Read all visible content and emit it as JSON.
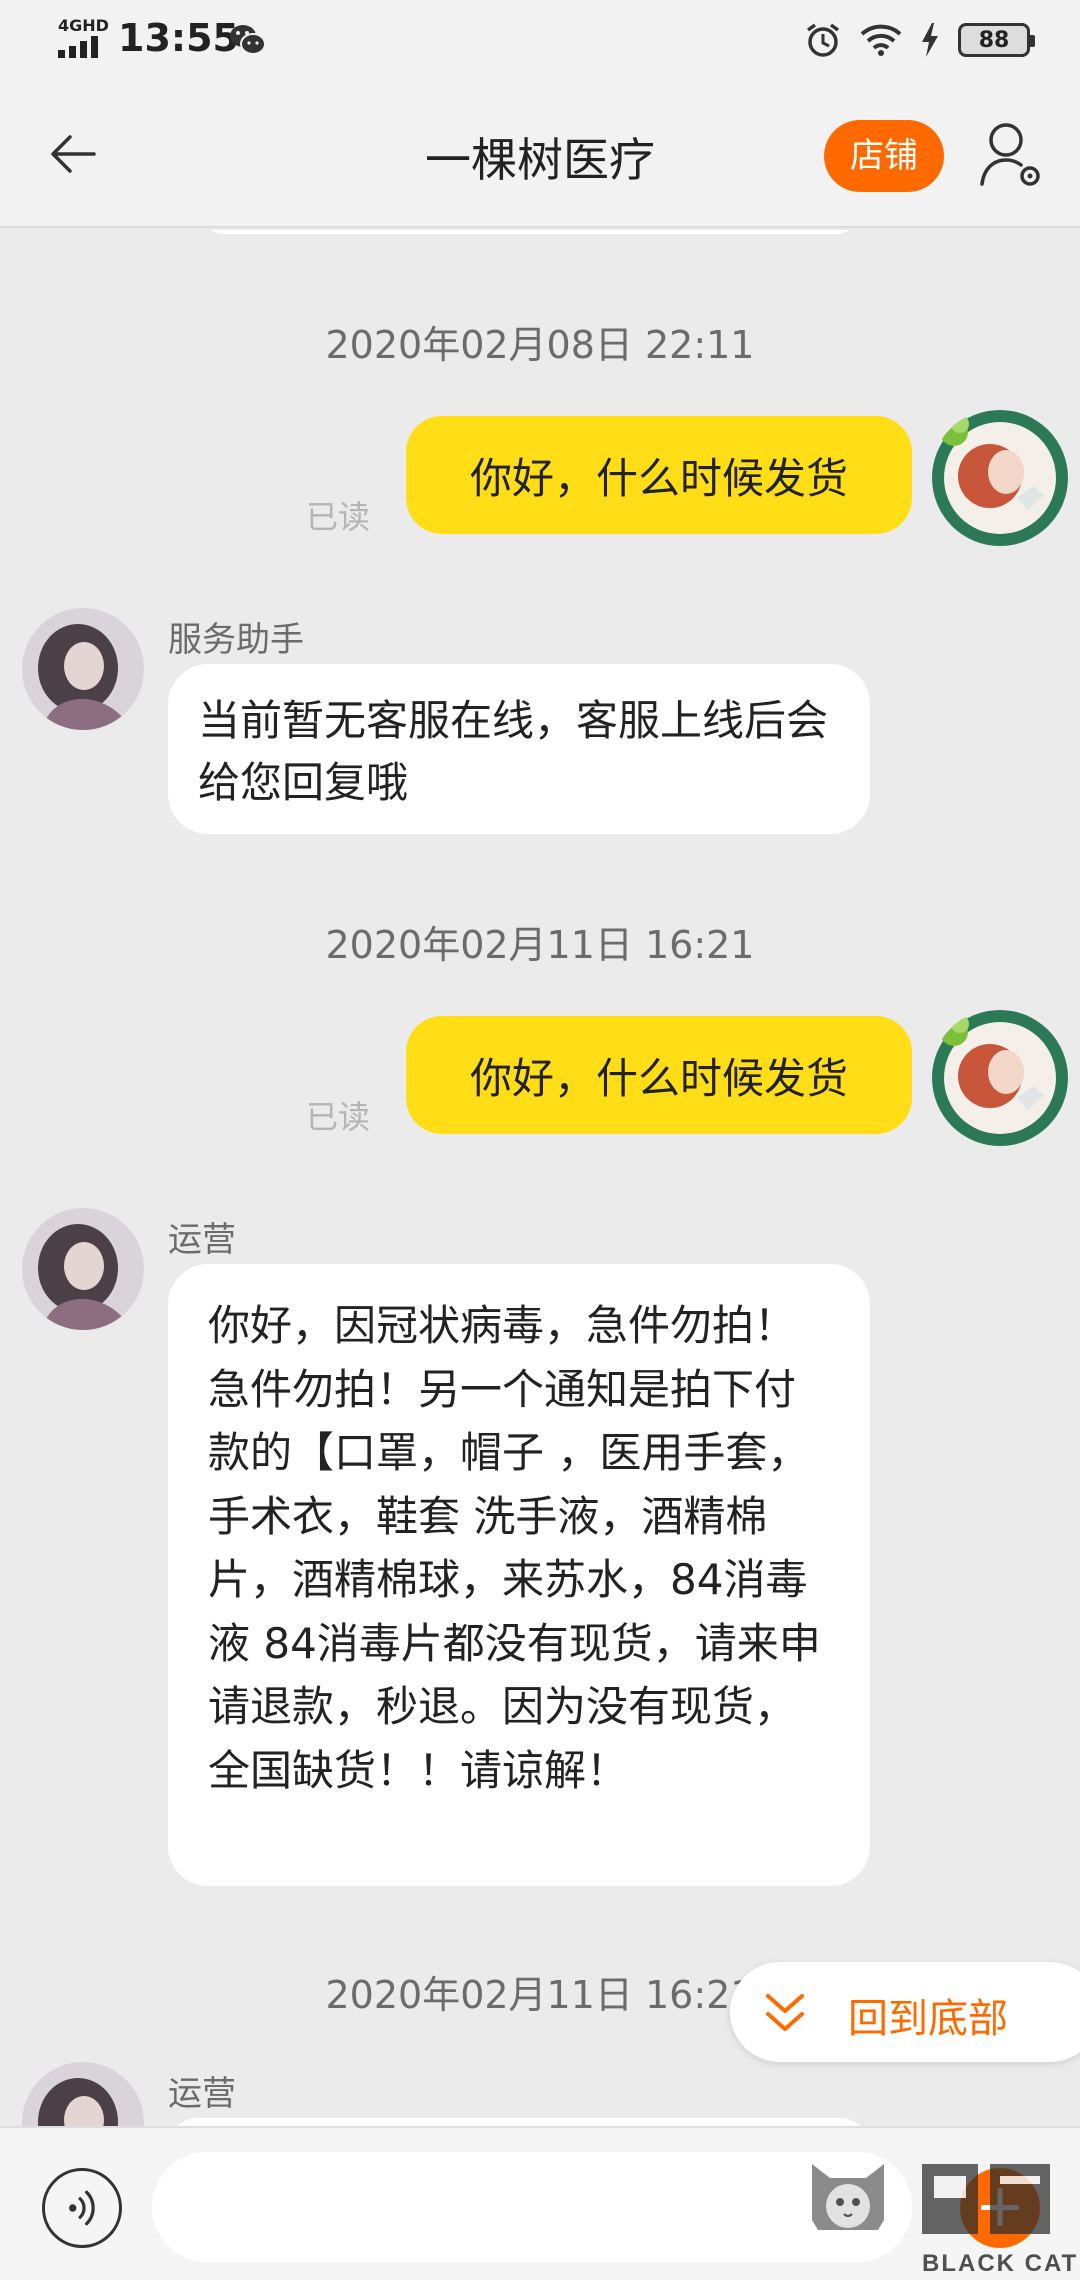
{
  "status_bar": {
    "network": "4GHD",
    "time": "13:55",
    "battery": "88"
  },
  "header": {
    "title": "一棵树医疗",
    "store_label": "店铺"
  },
  "messages": {
    "ts1": "2020年02月08日 22:11",
    "out1": "你好，什么时候发货",
    "read1": "已读",
    "sender1": "服务助手",
    "in1": "当前暂无客服在线，客服上线后会给您回复哦",
    "ts2": "2020年02月11日 16:21",
    "out2": "你好，什么时候发货",
    "read2": "已读",
    "sender2": "运营",
    "in2": "你好，因冠状病毒，急件勿拍！急件勿拍！另一个通知是拍下付款的【口罩，帽子 ，医用手套，手术衣，鞋套 洗手液，酒精棉片，酒精棉球，来苏水，84消毒液 84消毒片都没有现货，请来申请退款，秒退。因为没有现货，全国缺货！！请谅解！",
    "ts3": "2020年02月11日 16:21",
    "sender3": "运营"
  },
  "back_to_bottom_label": "回到底部",
  "input_bar": {
    "placeholder": ""
  },
  "watermark": {
    "brand": "BLACK CAT"
  },
  "colors": {
    "accent": "#ff6a00",
    "outgoing_bubble": "#ffde17",
    "chat_background": "#ebebeb"
  }
}
